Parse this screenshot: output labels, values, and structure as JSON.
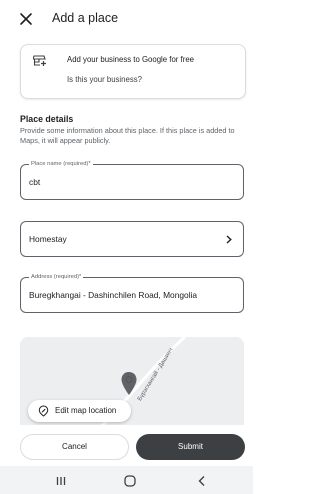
{
  "appbar": {
    "title": "Add a place",
    "close_icon": "close-icon"
  },
  "promo": {
    "icon": "store-add-icon",
    "text": "Add your business to Google for free",
    "link": "Is this your business?"
  },
  "place_details": {
    "title": "Place details",
    "description": "Provide some information about this place. If this place is added to Maps, it will appear publicly."
  },
  "fields": {
    "name": {
      "label": "Place name (required)*",
      "value": "cbt"
    },
    "category": {
      "value": "Homestay",
      "icon": "chevron-right-icon"
    },
    "address": {
      "label": "Address (required)*",
      "value": "Buregkhangai - Dashinchilen Road, Mongolia"
    }
  },
  "map": {
    "road_label": "Бүрэгхангай - Дашинч",
    "pin_icon": "map-pin-icon",
    "edit_button": {
      "label": "Edit map location",
      "icon": "location-edit-icon"
    }
  },
  "actions": {
    "cancel": "Cancel",
    "submit": "Submit"
  },
  "navbar": {
    "recents_icon": "recents-icon",
    "home_icon": "home-icon",
    "back_icon": "back-icon"
  },
  "colors": {
    "submit_bg": "#3c4043",
    "map_bg": "#eceeef",
    "navbar_bg": "#f1f3f4"
  }
}
